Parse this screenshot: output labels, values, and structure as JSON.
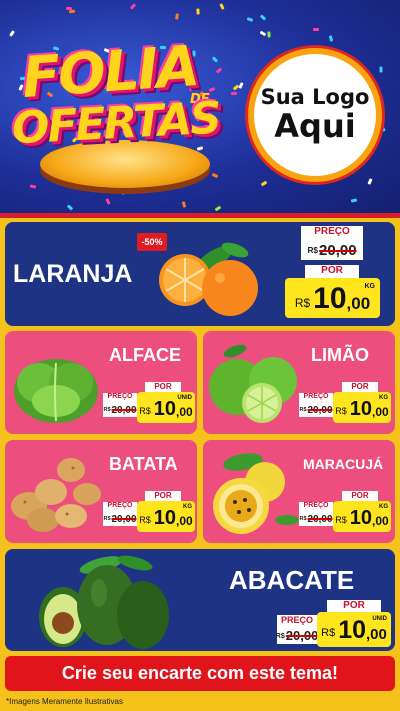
{
  "header": {
    "title_line1": "FOLIA",
    "title_de": "DE",
    "title_line2": "OFERTAS",
    "logo_line1": "Sua Logo",
    "logo_line2": "Aqui"
  },
  "labels": {
    "preco": "PREÇO",
    "por": "POR",
    "currency": "R$"
  },
  "products": {
    "laranja": {
      "name": "LARANJA",
      "discount": "-50%",
      "old_int": "20",
      "old_cents": ",00",
      "new_int": "10",
      "new_cents": ",00",
      "unit": "KG"
    },
    "alface": {
      "name": "ALFACE",
      "old_int": "20",
      "old_cents": ",00",
      "new_int": "10",
      "new_cents": ",00",
      "unit": "UNID"
    },
    "limao": {
      "name": "LIMÃO",
      "old_int": "20",
      "old_cents": ",00",
      "new_int": "10",
      "new_cents": ",00",
      "unit": "KG"
    },
    "batata": {
      "name": "BATATA",
      "old_int": "20",
      "old_cents": ",00",
      "new_int": "10",
      "new_cents": ",00",
      "unit": "KG"
    },
    "maracuja": {
      "name": "MARACUJÁ",
      "old_int": "20",
      "old_cents": ",00",
      "new_int": "10",
      "new_cents": ",00",
      "unit": "KG"
    },
    "abacate": {
      "name": "ABACATE",
      "old_int": "20",
      "old_cents": ",00",
      "new_int": "10",
      "new_cents": ",00",
      "unit": "UNID"
    }
  },
  "footer": {
    "cta": "Crie seu encarte com este tema!",
    "disclaimer": "*Imagens Meramente Ilustrativas"
  },
  "colors": {
    "background": "#f4c21b",
    "header_blue": "#1d2e96",
    "card_blue": "#1f3385",
    "card_pink": "#ec4e7e",
    "price_yellow": "#ffe51d",
    "accent_red": "#e0151c"
  }
}
